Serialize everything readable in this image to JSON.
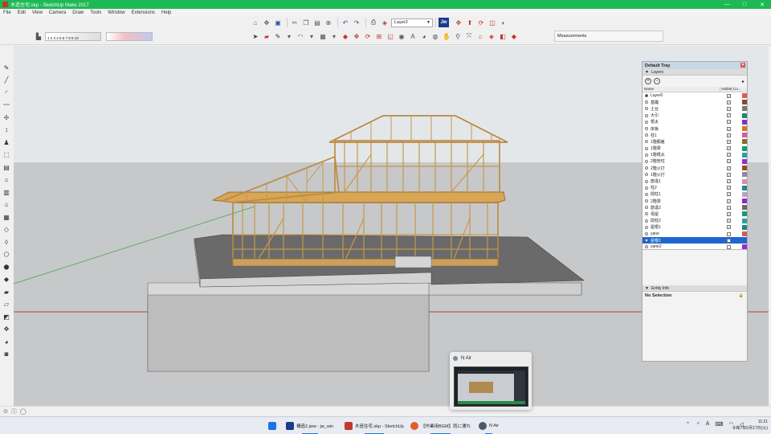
{
  "window": {
    "title": "木造住宅.skp - SketchUp Make 2017",
    "controls": [
      "—",
      "□",
      "✕"
    ]
  },
  "menu": [
    "File",
    "Edit",
    "View",
    "Camera",
    "Draw",
    "Tools",
    "Window",
    "Extensions",
    "Help"
  ],
  "toolbar": {
    "layer_select": "Layer2",
    "jw_label": "Jw",
    "measurements_label": "Measurements",
    "style_scale": "1  2  3  4  5  6  7  8  9  10"
  },
  "tray": {
    "title": "Default Tray",
    "layers_panel": "Layers",
    "columns": {
      "name": "Name",
      "visible": "Visible",
      "color": "Co..."
    },
    "layers": [
      {
        "name": "Layer0",
        "active": true,
        "visible": true,
        "color": "#e05a5a"
      },
      {
        "name": "基礎",
        "active": false,
        "visible": true,
        "color": "#8a4a2a"
      },
      {
        "name": "土台",
        "active": false,
        "visible": true,
        "color": "#777777"
      },
      {
        "name": "大引",
        "active": false,
        "visible": true,
        "color": "#1a8a7a"
      },
      {
        "name": "根太",
        "active": false,
        "visible": true,
        "color": "#8a2ad0"
      },
      {
        "name": "床板",
        "active": false,
        "visible": true,
        "color": "#d07a1a"
      },
      {
        "name": "柱1",
        "active": false,
        "visible": true,
        "color": "#d85aa0"
      },
      {
        "name": "1階胴差",
        "active": false,
        "visible": true,
        "color": "#8a6a2a"
      },
      {
        "name": "1階梁",
        "active": false,
        "visible": true,
        "color": "#1a9a6a"
      },
      {
        "name": "1階根太",
        "active": false,
        "visible": true,
        "color": "#2aa0a0"
      },
      {
        "name": "2階管柱",
        "active": false,
        "visible": true,
        "color": "#9a2ad0"
      },
      {
        "name": "2階火打",
        "active": false,
        "visible": true,
        "color": "#9a4a1a"
      },
      {
        "name": "1階火打",
        "active": false,
        "visible": true,
        "color": "#8a8aa0"
      },
      {
        "name": "筋違1",
        "active": false,
        "visible": true,
        "color": "#e08ab0"
      },
      {
        "name": "柱2",
        "active": false,
        "visible": true,
        "color": "#1a8a8a"
      },
      {
        "name": "間柱1",
        "active": false,
        "visible": true,
        "color": "#c0a0c0"
      },
      {
        "name": "2階梁",
        "active": false,
        "visible": true,
        "color": "#8a2ad0"
      },
      {
        "name": "筋違2",
        "active": false,
        "visible": true,
        "color": "#6a6a6a"
      },
      {
        "name": "母屋",
        "active": false,
        "visible": true,
        "color": "#1a9a6a"
      },
      {
        "name": "間柱2",
        "active": false,
        "visible": true,
        "color": "#2aa0a0"
      },
      {
        "name": "屋根1",
        "active": false,
        "visible": true,
        "color": "#1a8a7a"
      },
      {
        "name": "yane",
        "active": false,
        "visible": false,
        "color": "#d85a5a"
      },
      {
        "name": "屋根2",
        "active": false,
        "visible": true,
        "color": "#1e66d0",
        "selected": true
      },
      {
        "name": "yane2",
        "active": false,
        "visible": false,
        "color": "#9a2ad0"
      }
    ],
    "entity_panel": "Entity Info",
    "entity_selection": "No Selection"
  },
  "nair": {
    "title": "N Air"
  },
  "taskbar": {
    "items": [
      {
        "label": "構造2.jww - jw_win",
        "color": "#1a3a8a"
      },
      {
        "label": "木造住宅.skp - SketchUp",
        "color": "#c0392b"
      },
      {
        "label": "【作業用BGM】雨に濡れ",
        "color": "#e0602a"
      },
      {
        "label": "N Air",
        "color": "#4a5a6a"
      }
    ],
    "time": "11:21",
    "date": "令和7年6月17日(火)",
    "ime": "A"
  }
}
